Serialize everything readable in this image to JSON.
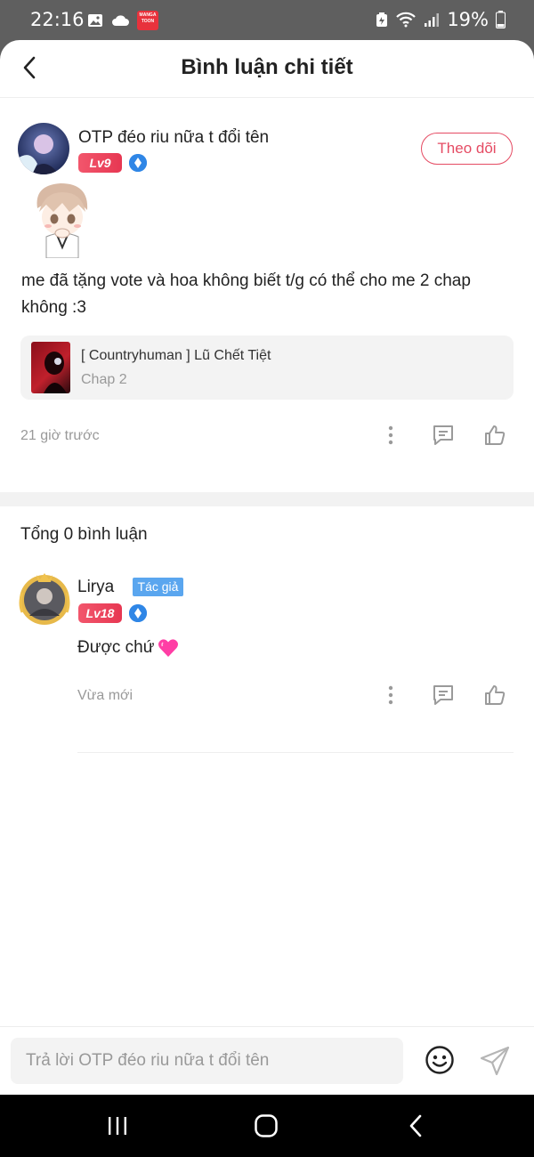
{
  "status_bar": {
    "time": "22:16",
    "battery": "19%",
    "manga_app_label": "MANGA TOON"
  },
  "header": {
    "title": "Bình luận chi tiết"
  },
  "comment": {
    "username": "OTP đéo riu nữa t đổi tên",
    "level": "Lv9",
    "follow_label": "Theo dõi",
    "text": "me đã tặng vote và hoa không biết t/g có thể cho me 2 chap không :3",
    "chapter_card": {
      "title": "[ Countryhuman ] Lũ Chết Tiệt",
      "subtitle": "Chap 2"
    },
    "timestamp": "21 giờ trước"
  },
  "replies_section": {
    "total_label": "Tổng 0 bình luận",
    "replies": [
      {
        "username": "Lirya",
        "author_tag": "Tác giả",
        "level": "Lv18",
        "text": "Được chứ",
        "timestamp": "Vừa mới"
      }
    ]
  },
  "input": {
    "placeholder": "Trả lời OTP đéo riu nữa t đổi tên"
  },
  "colors": {
    "accent": "#e54b63",
    "level_badge": "#e73752",
    "author_tag": "#5aa6ef",
    "vip_badge": "#2f86e6"
  },
  "icons": {
    "back": "chevron-left-icon",
    "more": "more-vertical-icon",
    "comment": "comment-icon",
    "like": "thumbs-up-icon",
    "emoji": "emoji-icon",
    "send": "send-icon"
  }
}
